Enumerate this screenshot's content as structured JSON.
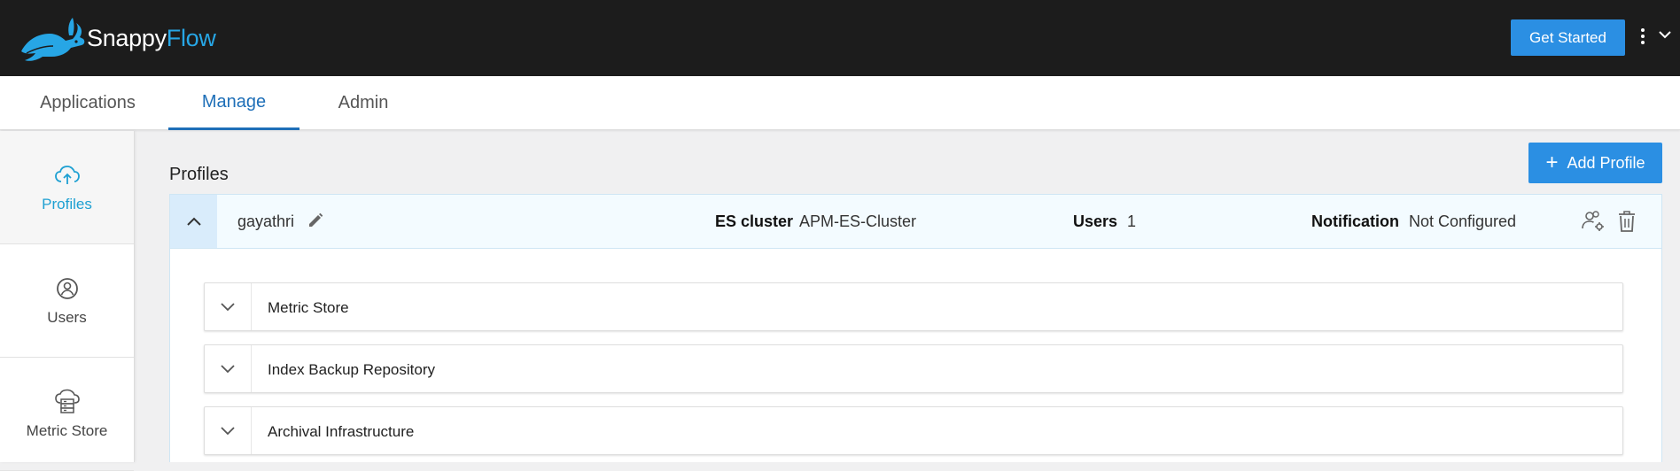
{
  "header": {
    "logo_text_a": "Snappy",
    "logo_text_b": "Flow",
    "get_started_label": "Get Started",
    "colors": {
      "background": "#1c1c1c",
      "brand_blue": "#27a6e5",
      "button": "#2b8fe3"
    }
  },
  "tabs": [
    {
      "label": "Applications",
      "active": false
    },
    {
      "label": "Manage",
      "active": true
    },
    {
      "label": "Admin",
      "active": false
    }
  ],
  "sidebar": {
    "items": [
      {
        "label": "Profiles",
        "icon": "cloud-upload-icon",
        "active": true
      },
      {
        "label": "Users",
        "icon": "user-circle-icon",
        "active": false
      },
      {
        "label": "Metric Store",
        "icon": "cloud-storage-icon",
        "active": false
      }
    ]
  },
  "main": {
    "title": "Profiles",
    "add_profile_label": "Add Profile",
    "add_profile_icon": "plus-icon"
  },
  "profile": {
    "name": "gayathri",
    "es_cluster_label": "ES cluster",
    "es_cluster_value": "APM-ES-Cluster",
    "users_label": "Users",
    "users_value": "1",
    "notification_label": "Notification",
    "notification_value": "Not Configured",
    "sections": [
      {
        "label": "Metric Store"
      },
      {
        "label": "Index Backup Repository"
      },
      {
        "label": "Archival Infrastructure"
      }
    ]
  }
}
